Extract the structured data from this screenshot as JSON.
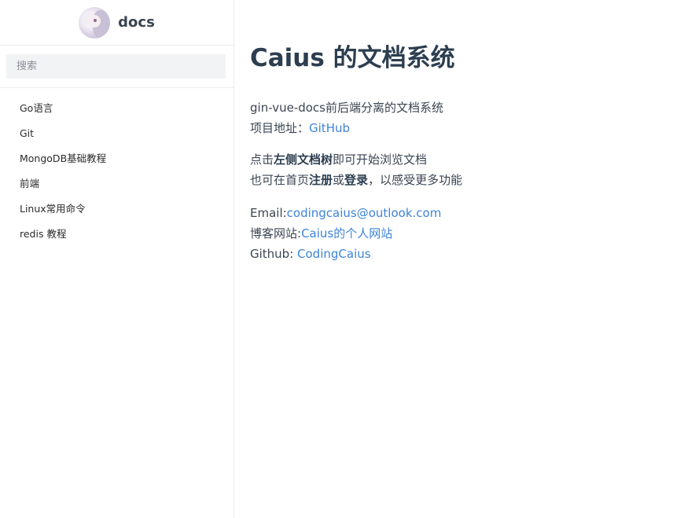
{
  "brand": {
    "name": "docs"
  },
  "search": {
    "placeholder": "搜索"
  },
  "sidebar": {
    "items": [
      {
        "label": "Go语言"
      },
      {
        "label": "Git"
      },
      {
        "label": "MongoDB基础教程"
      },
      {
        "label": "前端"
      },
      {
        "label": "Linux常用命令"
      },
      {
        "label": "redis 教程"
      }
    ]
  },
  "main": {
    "title": "Caius 的文档系统",
    "intro": "gin-vue-docs前后端分离的文档系统",
    "repo_label": "项目地址：",
    "repo_link": "GitHub",
    "hint_prefix": "点击",
    "hint_bold": "左侧文档树",
    "hint_suffix": "即可开始浏览文档",
    "also_prefix": "也可在首页",
    "also_register": "注册",
    "also_or": "或",
    "also_login": "登录",
    "also_suffix": "，以感受更多功能",
    "email_label": "Email:",
    "email_link": "codingcaius@outlook.com",
    "blog_label": "博客网站:",
    "blog_link": "Caius的个人网站",
    "github_label": "Github: ",
    "github_link": "CodingCaius"
  },
  "colors": {
    "link": "#3d84d6",
    "text": "#2c3e50",
    "search_bg": "#f2f3f5",
    "border": "#eaecef"
  }
}
